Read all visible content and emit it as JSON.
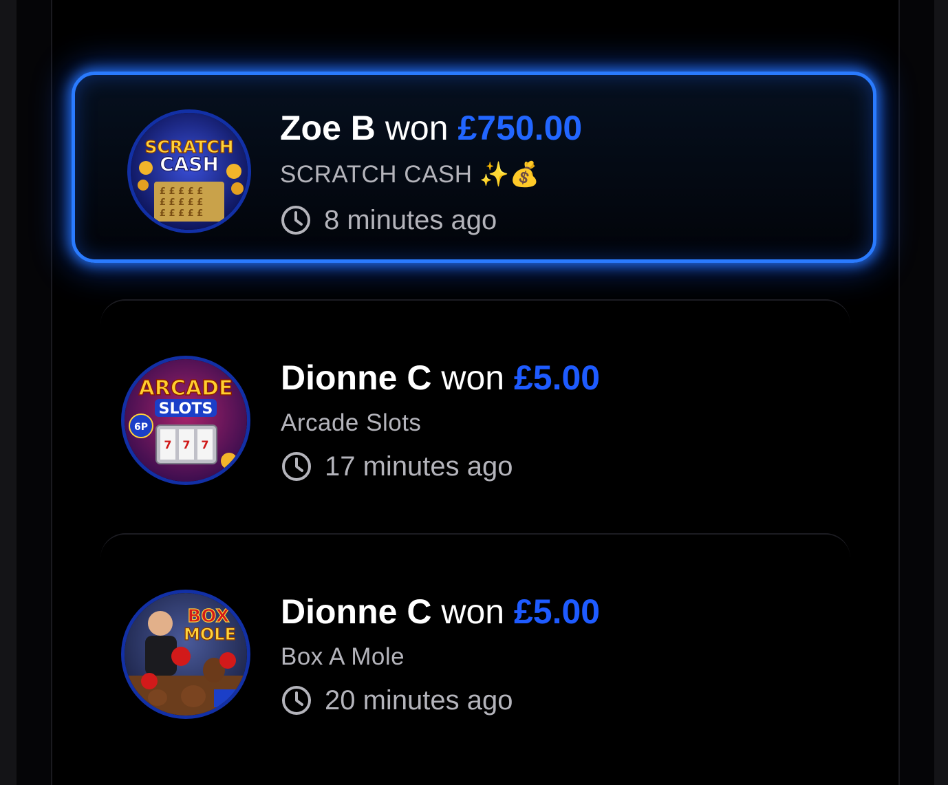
{
  "wins": [
    {
      "player": "Zoe B",
      "won_word": "won",
      "amount": "£750.00",
      "game": "SCRATCH CASH ✨💰",
      "time_ago": "8 minutes ago",
      "thumb_icon": "scratch-cash-thumbnail",
      "thumb_text_1": "SCRATCH",
      "thumb_text_2": "CASH",
      "highlighted": true
    },
    {
      "player": "Dionne C",
      "won_word": "won",
      "amount": "£5.00",
      "game": "Arcade Slots",
      "time_ago": "17 minutes ago",
      "thumb_icon": "arcade-slots-thumbnail",
      "thumb_text_1": "ARCADE",
      "thumb_text_2": "SLOTS",
      "thumb_badge": "6P",
      "highlighted": false
    },
    {
      "player": "Dionne C",
      "won_word": "won",
      "amount": "£5.00",
      "game": "Box A Mole",
      "time_ago": "20 minutes ago",
      "thumb_icon": "box-a-mole-thumbnail",
      "thumb_text_1": "BOX",
      "thumb_text_2": "MOLE",
      "highlighted": false
    }
  ],
  "colors": {
    "accent_blue": "#2266ff",
    "glow_blue": "#2a7bff",
    "text_primary": "#ffffff",
    "text_secondary": "#b4b4bb",
    "background": "#000000"
  },
  "icons": {
    "time": "clock-icon"
  }
}
